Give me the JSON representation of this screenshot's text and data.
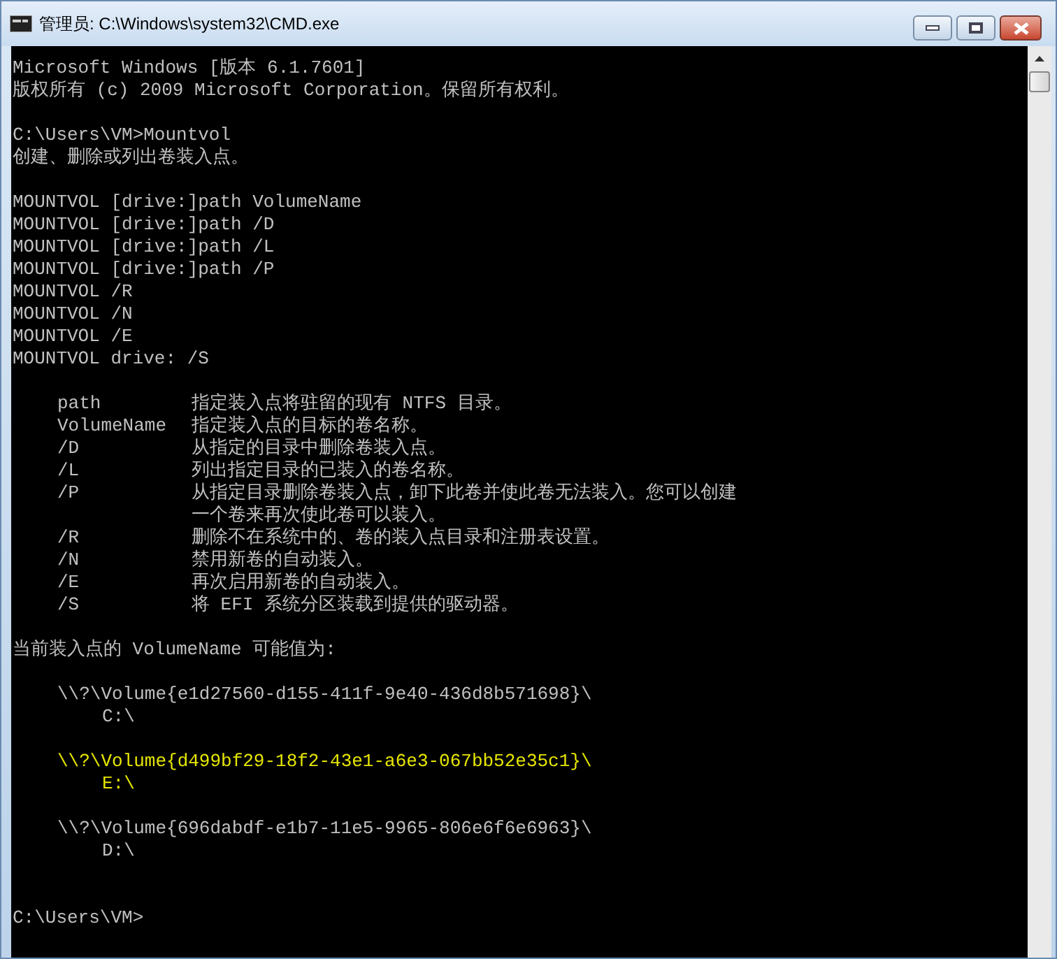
{
  "window": {
    "title": "管理员: C:\\Windows\\system32\\CMD.exe"
  },
  "console": {
    "lines": [
      {
        "kind": "text",
        "text": "Microsoft Windows [版本 6.1.7601]"
      },
      {
        "kind": "text",
        "text": "版权所有 (c) 2009 Microsoft Corporation。保留所有权利。"
      },
      {
        "kind": "blank"
      },
      {
        "kind": "text",
        "text": "C:\\Users\\VM>Mountvol"
      },
      {
        "kind": "text",
        "text": "创建、删除或列出卷装入点。"
      },
      {
        "kind": "blank"
      },
      {
        "kind": "text",
        "text": "MOUNTVOL [drive:]path VolumeName"
      },
      {
        "kind": "text",
        "text": "MOUNTVOL [drive:]path /D"
      },
      {
        "kind": "text",
        "text": "MOUNTVOL [drive:]path /L"
      },
      {
        "kind": "text",
        "text": "MOUNTVOL [drive:]path /P"
      },
      {
        "kind": "text",
        "text": "MOUNTVOL /R"
      },
      {
        "kind": "text",
        "text": "MOUNTVOL /N"
      },
      {
        "kind": "text",
        "text": "MOUNTVOL /E"
      },
      {
        "kind": "text",
        "text": "MOUNTVOL drive: /S"
      },
      {
        "kind": "blank"
      },
      {
        "kind": "option",
        "option": "path",
        "description": "指定装入点将驻留的现有 NTFS 目录。"
      },
      {
        "kind": "option",
        "option": "VolumeName",
        "description": "指定装入点的目标的卷名称。"
      },
      {
        "kind": "option",
        "option": "/D",
        "description": "从指定的目录中删除卷装入点。"
      },
      {
        "kind": "option",
        "option": "/L",
        "description": "列出指定目录的已装入的卷名称。"
      },
      {
        "kind": "option",
        "option": "/P",
        "description": "从指定目录删除卷装入点，卸下此卷并使此卷无法装入。您可以创建"
      },
      {
        "kind": "option",
        "description": "一个卷来再次使此卷可以装入。"
      },
      {
        "kind": "option",
        "option": "/R",
        "description": "删除不在系统中的、卷的装入点目录和注册表设置。"
      },
      {
        "kind": "option",
        "option": "/N",
        "description": "禁用新卷的自动装入。"
      },
      {
        "kind": "option",
        "option": "/E",
        "description": "再次启用新卷的自动装入。"
      },
      {
        "kind": "option",
        "option": "/S",
        "description": "将 EFI 系统分区装载到提供的驱动器。"
      },
      {
        "kind": "blank"
      },
      {
        "kind": "text",
        "text": "当前装入点的 VolumeName 可能值为:"
      },
      {
        "kind": "blank"
      },
      {
        "kind": "volume",
        "path": "\\\\?\\Volume{e1d27560-d155-411f-9e40-436d8b571698}\\",
        "drive": "C:\\",
        "highlighted": false
      },
      {
        "kind": "blank"
      },
      {
        "kind": "volume",
        "path": "\\\\?\\Volume{d499bf29-18f2-43e1-a6e3-067bb52e35c1}\\",
        "drive": "E:\\",
        "highlighted": true
      },
      {
        "kind": "blank"
      },
      {
        "kind": "volume",
        "path": "\\\\?\\Volume{696dabdf-e1b7-11e5-9965-806e6f6e6963}\\",
        "drive": "D:\\",
        "highlighted": false
      },
      {
        "kind": "blank"
      },
      {
        "kind": "blank"
      },
      {
        "kind": "text",
        "text": "C:\\Users\\VM>"
      }
    ]
  }
}
